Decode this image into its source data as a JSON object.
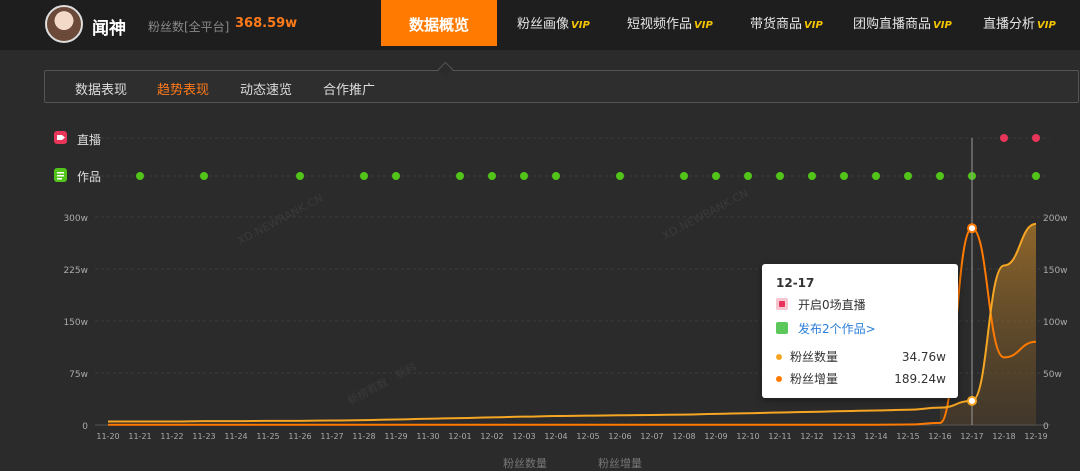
{
  "header": {
    "user_name": "闻神",
    "fans_label": "粉丝数[全平台]",
    "fans_value": "368.59w",
    "tabs": [
      {
        "label": "数据概览",
        "vip": ""
      },
      {
        "label": "粉丝画像",
        "vip": "VIP"
      },
      {
        "label": "短视频作品",
        "vip": "VIP"
      },
      {
        "label": "带货商品",
        "vip": "VIP"
      },
      {
        "label": "团购直播商品",
        "vip": "VIP"
      },
      {
        "label": "直播分析",
        "vip": "VIP"
      }
    ]
  },
  "subtabs": [
    "数据表现",
    "趋势表现",
    "动态速览",
    "合作推广"
  ],
  "rows": {
    "live": "直播",
    "works": "作品"
  },
  "tooltip": {
    "date": "12-17",
    "live_text": "开启0场直播",
    "works_text": "发布2个作品>",
    "series": [
      {
        "name": "粉丝数量",
        "value": "34.76w",
        "color": "#f5a623"
      },
      {
        "name": "粉丝增量",
        "value": "189.24w",
        "color": "#ff7a00"
      }
    ]
  },
  "legend": [
    "粉丝数量",
    "粉丝增量"
  ],
  "watermarks": [
    "XD.NEWRANK.CN",
    "XD.NEWRANK.CN",
    "新榜有数 · 新科",
    "新榜有数 · 新科"
  ],
  "colors": {
    "accent": "#ff7a00",
    "live": "#e8365a",
    "works": "#52c41a",
    "series1": "#f5a623",
    "series2": "#ff7a00"
  },
  "chart_data": {
    "type": "line",
    "x": [
      "11-20",
      "11-21",
      "11-22",
      "11-23",
      "11-24",
      "11-25",
      "11-26",
      "11-27",
      "11-28",
      "11-29",
      "11-30",
      "12-01",
      "12-02",
      "12-03",
      "12-04",
      "12-05",
      "12-06",
      "12-07",
      "12-08",
      "12-09",
      "12-10",
      "12-11",
      "12-12",
      "12-13",
      "12-14",
      "12-15",
      "12-16",
      "12-17",
      "12-18",
      "12-19"
    ],
    "y_left_ticks": [
      "0",
      "75w",
      "150w",
      "225w",
      "300w"
    ],
    "y_left_range": [
      0,
      300
    ],
    "y_right_ticks": [
      "0",
      "50w",
      "100w",
      "150w",
      "200w"
    ],
    "y_right_range": [
      0,
      200
    ],
    "series": [
      {
        "name": "粉丝数量",
        "axis": "left",
        "values": [
          5,
          5,
          5,
          5.5,
          5.5,
          6,
          6,
          6.5,
          7,
          8,
          9,
          10,
          11,
          12,
          13,
          13.5,
          14,
          14.5,
          15,
          16,
          17,
          18,
          19,
          20,
          21,
          22,
          25,
          34.76,
          230,
          290
        ]
      },
      {
        "name": "粉丝增量",
        "axis": "right",
        "values": [
          0.3,
          0.3,
          0.3,
          0.3,
          0.3,
          0.3,
          0.3,
          0.3,
          0.3,
          0.3,
          0.3,
          0.3,
          0.3,
          0.3,
          0.3,
          0.3,
          0.3,
          0.3,
          0.3,
          0.3,
          0.3,
          0.3,
          0.3,
          0.3,
          0.3,
          0.5,
          2,
          189.24,
          65,
          80
        ]
      }
    ],
    "live_markers": [
      "12-18",
      "12-19"
    ],
    "works_markers": [
      "11-21",
      "11-23",
      "11-26",
      "11-28",
      "11-29",
      "12-01",
      "12-02",
      "12-03",
      "12-04",
      "12-06",
      "12-08",
      "12-09",
      "12-10",
      "12-11",
      "12-12",
      "12-13",
      "12-14",
      "12-15",
      "12-16",
      "12-17",
      "12-19"
    ]
  }
}
